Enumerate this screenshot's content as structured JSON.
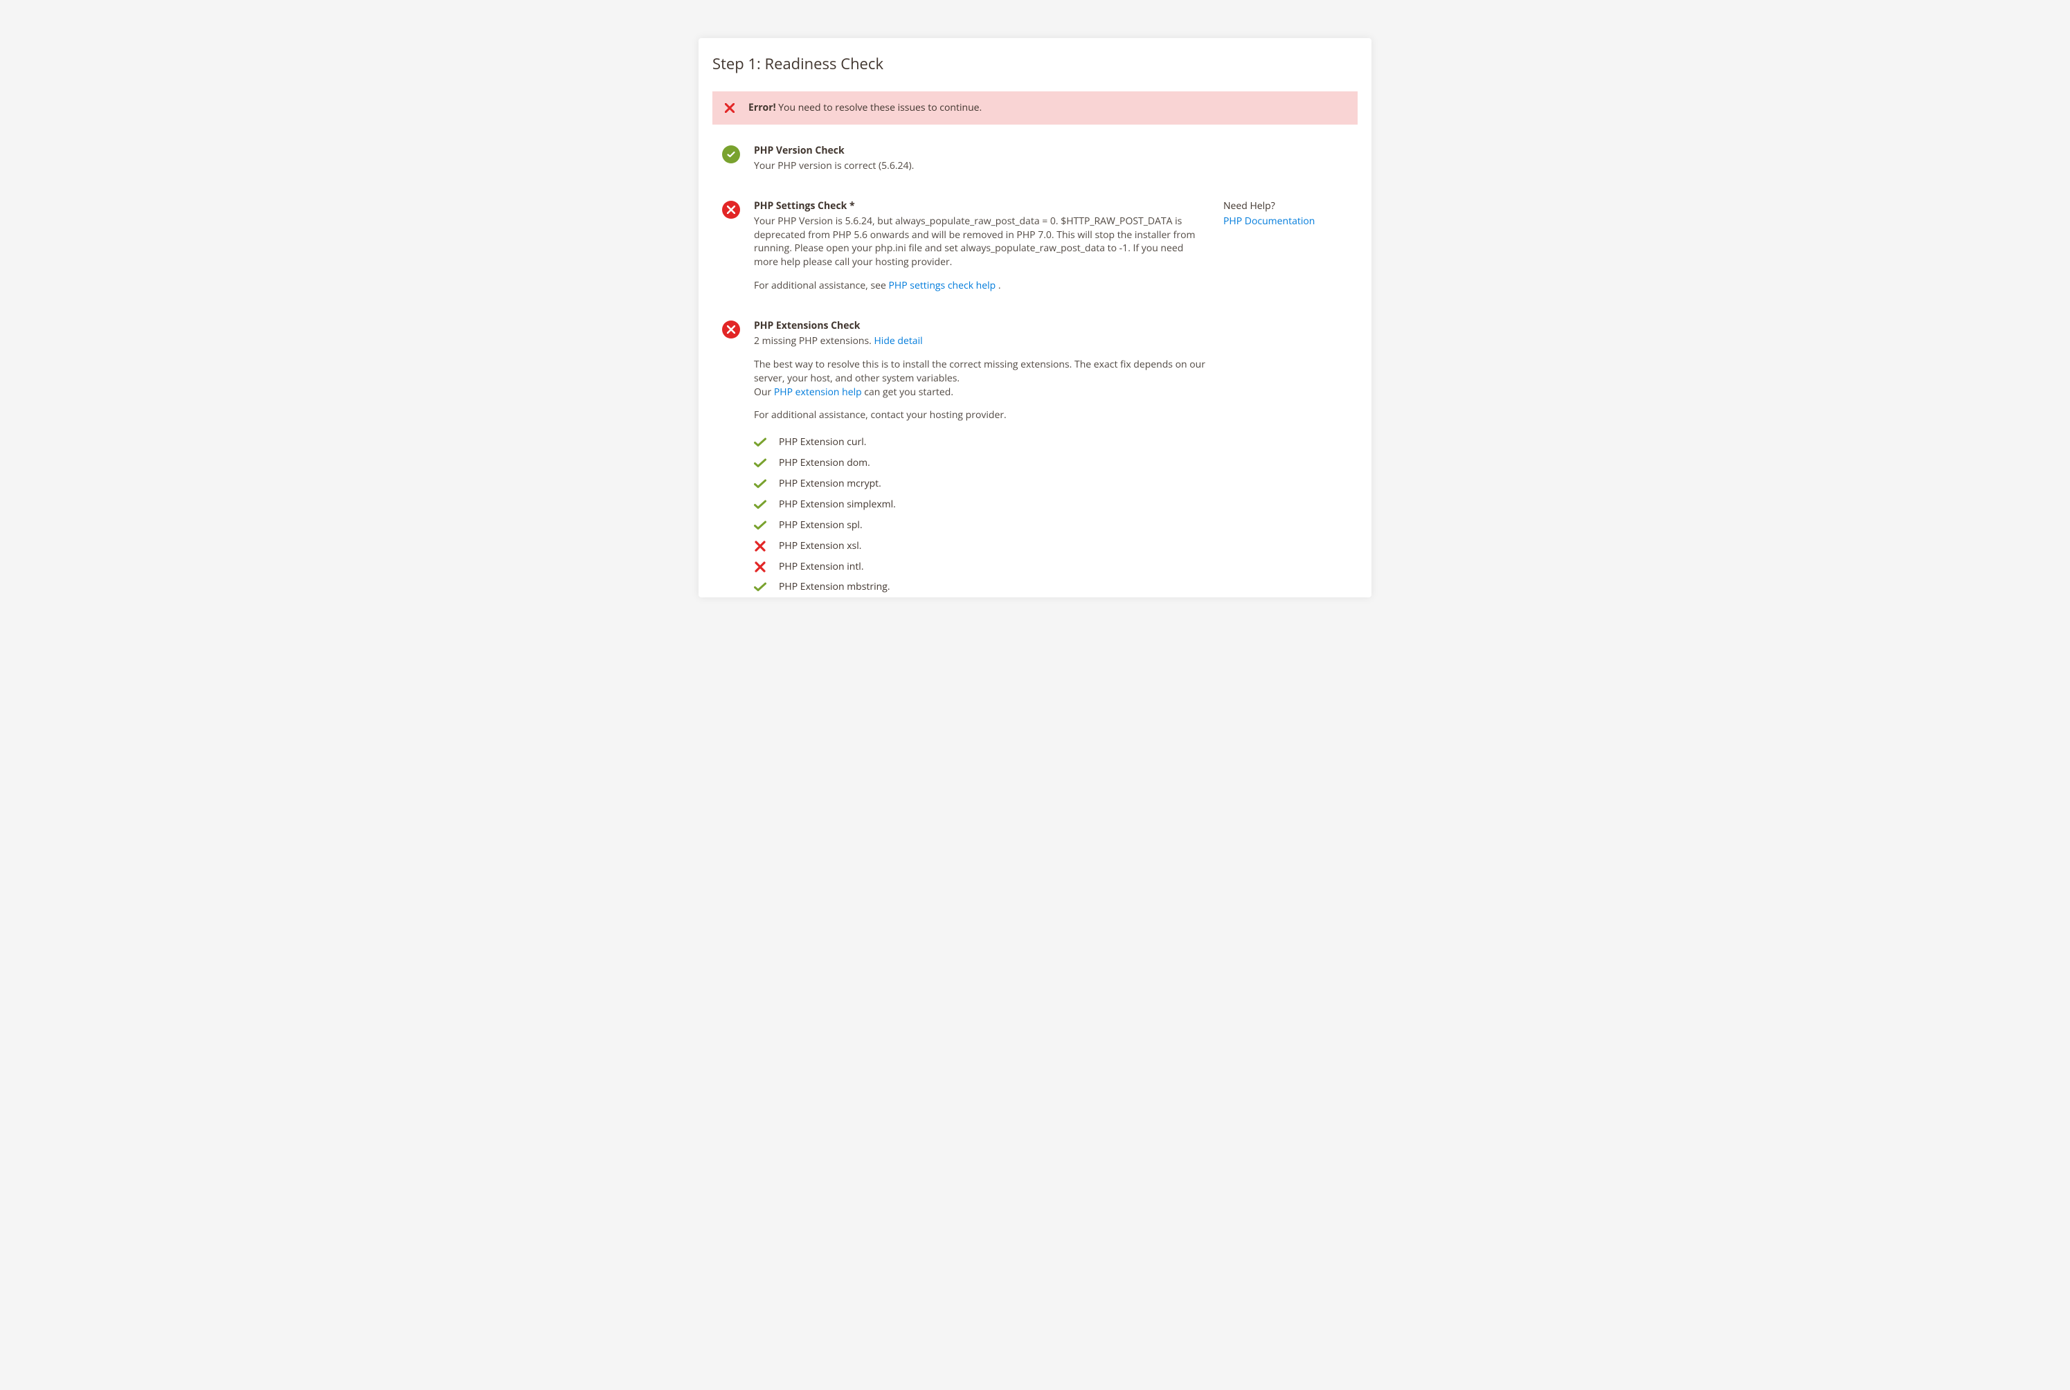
{
  "title": "Step 1: Readiness Check",
  "alert": {
    "strong": "Error!",
    "text": " You need to resolve these issues to continue."
  },
  "section_version": {
    "heading": "PHP Version Check",
    "text": "Your PHP version is correct (5.6.24)."
  },
  "section_settings": {
    "heading": "PHP Settings Check *",
    "body": "Your PHP Version is 5.6.24, but always_populate_raw_post_data = 0. $HTTP_RAW_POST_DATA is deprecated from PHP 5.6 onwards and will be removed in PHP 7.0. This will stop the installer from running. Please open your php.ini file and set always_populate_raw_post_data to -1. If you need more help please call your hosting provider.",
    "assist_prefix": "For additional assistance, see ",
    "assist_link": "PHP settings check help",
    "assist_suffix": " .",
    "help_q": "Need Help?",
    "help_link": "PHP Documentation"
  },
  "section_ext": {
    "heading": "PHP Extensions Check",
    "summary_prefix": "2 missing PHP extensions. ",
    "toggle": "Hide detail",
    "resolve": "The best way to resolve this is to install the correct missing extensions. The exact fix depends on our server, your host, and other system variables.",
    "our_prefix": "Our ",
    "our_link": "PHP extension help",
    "our_suffix": " can get you started.",
    "contact": "For additional assistance, contact your hosting provider.",
    "items": [
      {
        "ok": true,
        "label": "PHP Extension curl."
      },
      {
        "ok": true,
        "label": "PHP Extension dom."
      },
      {
        "ok": true,
        "label": "PHP Extension mcrypt."
      },
      {
        "ok": true,
        "label": "PHP Extension simplexml."
      },
      {
        "ok": true,
        "label": "PHP Extension spl."
      },
      {
        "ok": false,
        "label": "PHP Extension xsl."
      },
      {
        "ok": false,
        "label": "PHP Extension intl."
      },
      {
        "ok": true,
        "label": "PHP Extension mbstring."
      }
    ]
  }
}
